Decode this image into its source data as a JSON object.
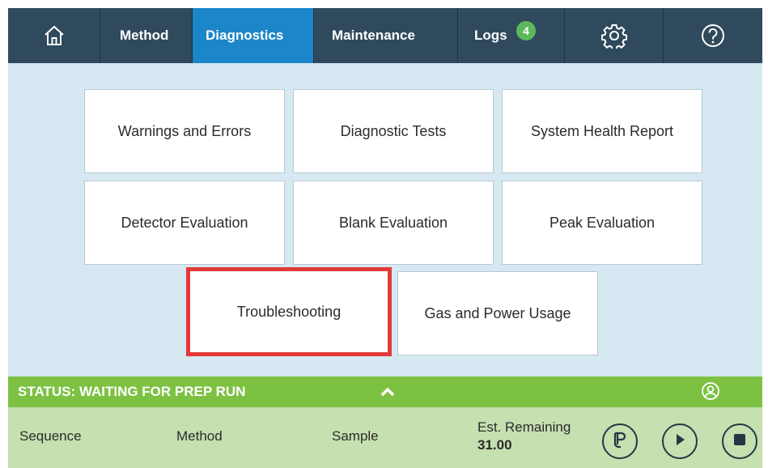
{
  "nav": {
    "home_icon": "home-icon",
    "method_label": "Method",
    "diagnostics_label": "Diagnostics",
    "maintenance_label": "Maintenance",
    "logs_label": "Logs",
    "logs_badge": "4",
    "settings_icon": "gear-icon",
    "help_icon": "help-icon",
    "active_tab": "Diagnostics",
    "active_color": "#1b86c9"
  },
  "tiles": {
    "warnings_errors": "Warnings and Errors",
    "diagnostic_tests": "Diagnostic Tests",
    "system_health": "System Health Report",
    "detector_eval": "Detector Evaluation",
    "blank_eval": "Blank Evaluation",
    "peak_eval": "Peak Evaluation",
    "troubleshooting": "Troubleshooting",
    "gas_power": "Gas and Power Usage",
    "highlighted": "Troubleshooting"
  },
  "status": {
    "text": "STATUS: WAITING FOR PREP RUN",
    "color": "#7dc142",
    "expand_icon": "chevron-up-icon",
    "user_icon": "user-icon"
  },
  "info": {
    "sequence_label": "Sequence",
    "method_label": "Method",
    "sample_label": "Sample",
    "remaining_label": "Est. Remaining",
    "remaining_value": "31.00",
    "prep_icon": "prep-run-icon",
    "play_icon": "play-icon",
    "stop_icon": "stop-icon"
  }
}
